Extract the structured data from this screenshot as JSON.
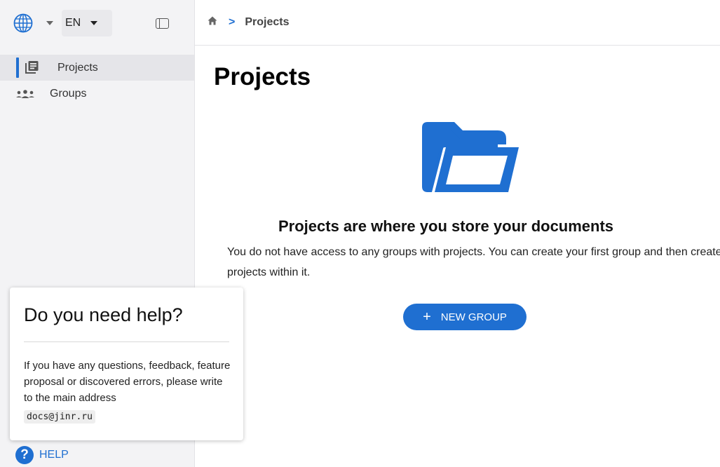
{
  "sidebar": {
    "language": "EN",
    "items": [
      {
        "label": "Projects",
        "icon": "projects-icon",
        "active": true
      },
      {
        "label": "Groups",
        "icon": "groups-icon",
        "active": false
      }
    ],
    "help_label": "HELP",
    "help_icon_glyph": "?"
  },
  "help_popover": {
    "title": "Do you need help?",
    "text": "If you have any questions, feedback, feature proposal or discovered errors, please write to the main address",
    "email": "docs@jinr.ru"
  },
  "breadcrumb": {
    "home_icon": "home-icon",
    "separator": ">",
    "current": "Projects"
  },
  "main": {
    "title": "Projects",
    "empty_title": "Projects are where you store your documents",
    "empty_desc": "You do not have access to any groups with projects. You can create your first group and then create projects within it.",
    "new_group_plus": "+",
    "new_group_label": "NEW GROUP"
  },
  "colors": {
    "accent": "#1f6fd1",
    "sidebar_bg": "#f3f3f5"
  }
}
